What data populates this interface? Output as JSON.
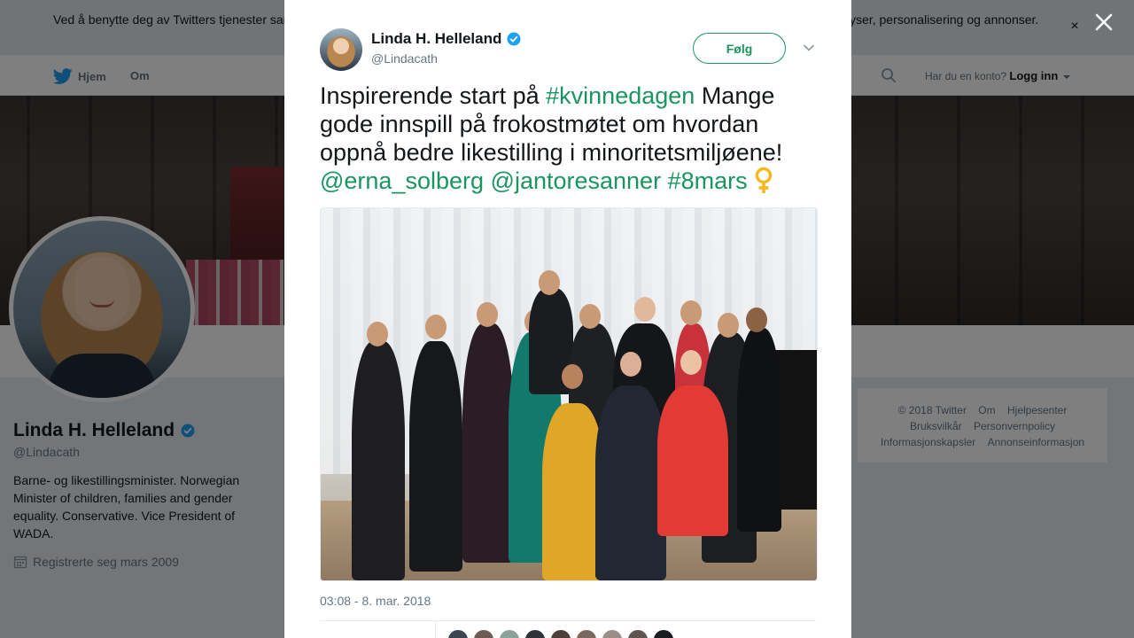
{
  "cookie_banner": {
    "text": "Ved å benytte deg av Twitters tjenester samtykker du i bruken av informasjonskapsler. Twitter og partnere bruker informasjonskapsler til bl.a. analyser, personalisering og annonser.",
    "close_glyph": "×"
  },
  "topnav": {
    "home_label": "Hjem",
    "about_label": "Om",
    "account_prompt": "Har du en konto?",
    "login_label": "Logg inn"
  },
  "profile": {
    "name": "Linda H. Helleland",
    "handle": "@Lindacath",
    "bio": "Barne- og likestillingsminister. Norwegian Minister of children, families and gender equality. Conservative. Vice President of WADA.",
    "joined": "Registrerte seg mars 2009"
  },
  "footer": {
    "copyright": "© 2018 Twitter",
    "links": [
      "Om",
      "Hjelpesenter",
      "Bruksvilkår",
      "Personvernpolicy",
      "Informasjonskapsler",
      "Annonseinformasjon"
    ]
  },
  "tweet": {
    "author_name": "Linda H. Helleland",
    "author_handle": "@Lindacath",
    "follow_label": "Følg",
    "text_1": "Inspirerende start på ",
    "tag_1": "#kvinnedagen",
    "text_2": " Mange gode innspill på frokostmøtet om hvordan oppnå bedre likestilling i minoritetsmiljøene! ",
    "mention_1": "@erna_solberg",
    "mention_2": "@jantoresanner",
    "tag_2": "#8mars",
    "timestamp": "03:08 - 8. mar. 2018"
  },
  "colors": {
    "accent": "#1b9560",
    "verified": "#1da1f2",
    "twitter_blue": "#1da1f2"
  },
  "icons": {
    "twitter_bird": "twitter-bird-icon",
    "search": "search-icon",
    "verified": "verified-badge-icon",
    "calendar": "calendar-icon",
    "close": "close-icon",
    "chevron": "chevron-down-icon",
    "venus": "female-sign-emoji"
  }
}
